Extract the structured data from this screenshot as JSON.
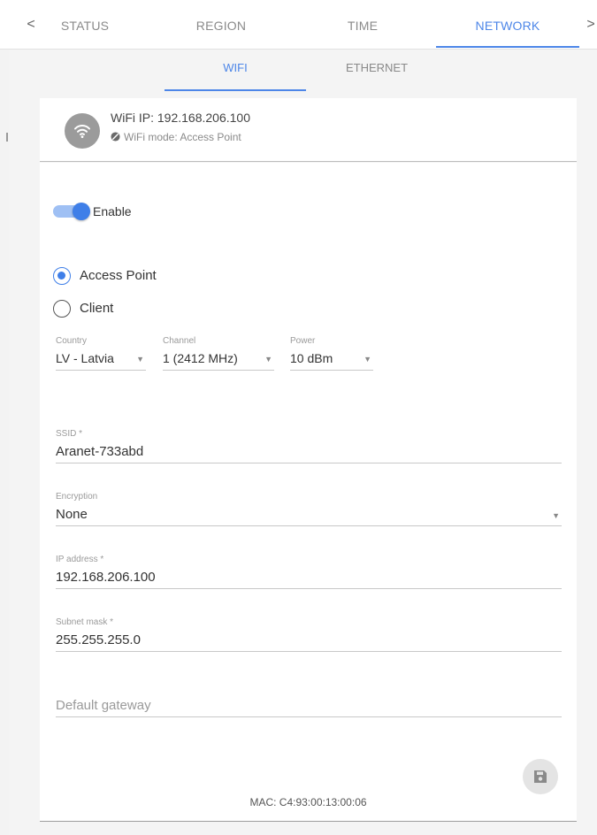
{
  "nav": {
    "prev_arrow": "<",
    "next_arrow": ">",
    "tabs": [
      "STATUS",
      "REGION",
      "TIME",
      "NETWORK"
    ],
    "active_tab": "NETWORK"
  },
  "subnav": {
    "tabs": [
      "WIFI",
      "ETHERNET"
    ],
    "active": "WIFI"
  },
  "info": {
    "title": "WiFi IP: 192.168.206.100",
    "subtitle": "WiFi mode: Access Point",
    "icon": "wifi-icon"
  },
  "form": {
    "enable_label": "Enable",
    "enable_on": true,
    "mode_options": [
      "Access Point",
      "Client"
    ],
    "mode_selected": "Access Point",
    "country": {
      "label": "Country",
      "value": "LV - Latvia"
    },
    "channel": {
      "label": "Channel",
      "value": "1 (2412 MHz)"
    },
    "power": {
      "label": "Power",
      "value": "10 dBm"
    },
    "ssid": {
      "label": "SSID *",
      "value": "Aranet-733abd"
    },
    "encryption": {
      "label": "Encryption",
      "value": "None"
    },
    "ip_address": {
      "label": "IP address *",
      "value": "192.168.206.100"
    },
    "subnet_mask": {
      "label": "Subnet mask *",
      "value": "255.255.255.0"
    },
    "default_gateway": {
      "placeholder": "Default gateway"
    }
  },
  "footer": {
    "mac": "MAC: C4:93:00:13:00:06"
  },
  "colors": {
    "accent": "#4d86e8",
    "toggle_track": "#9fc0f4",
    "icon_grey": "#9b9b9b"
  }
}
